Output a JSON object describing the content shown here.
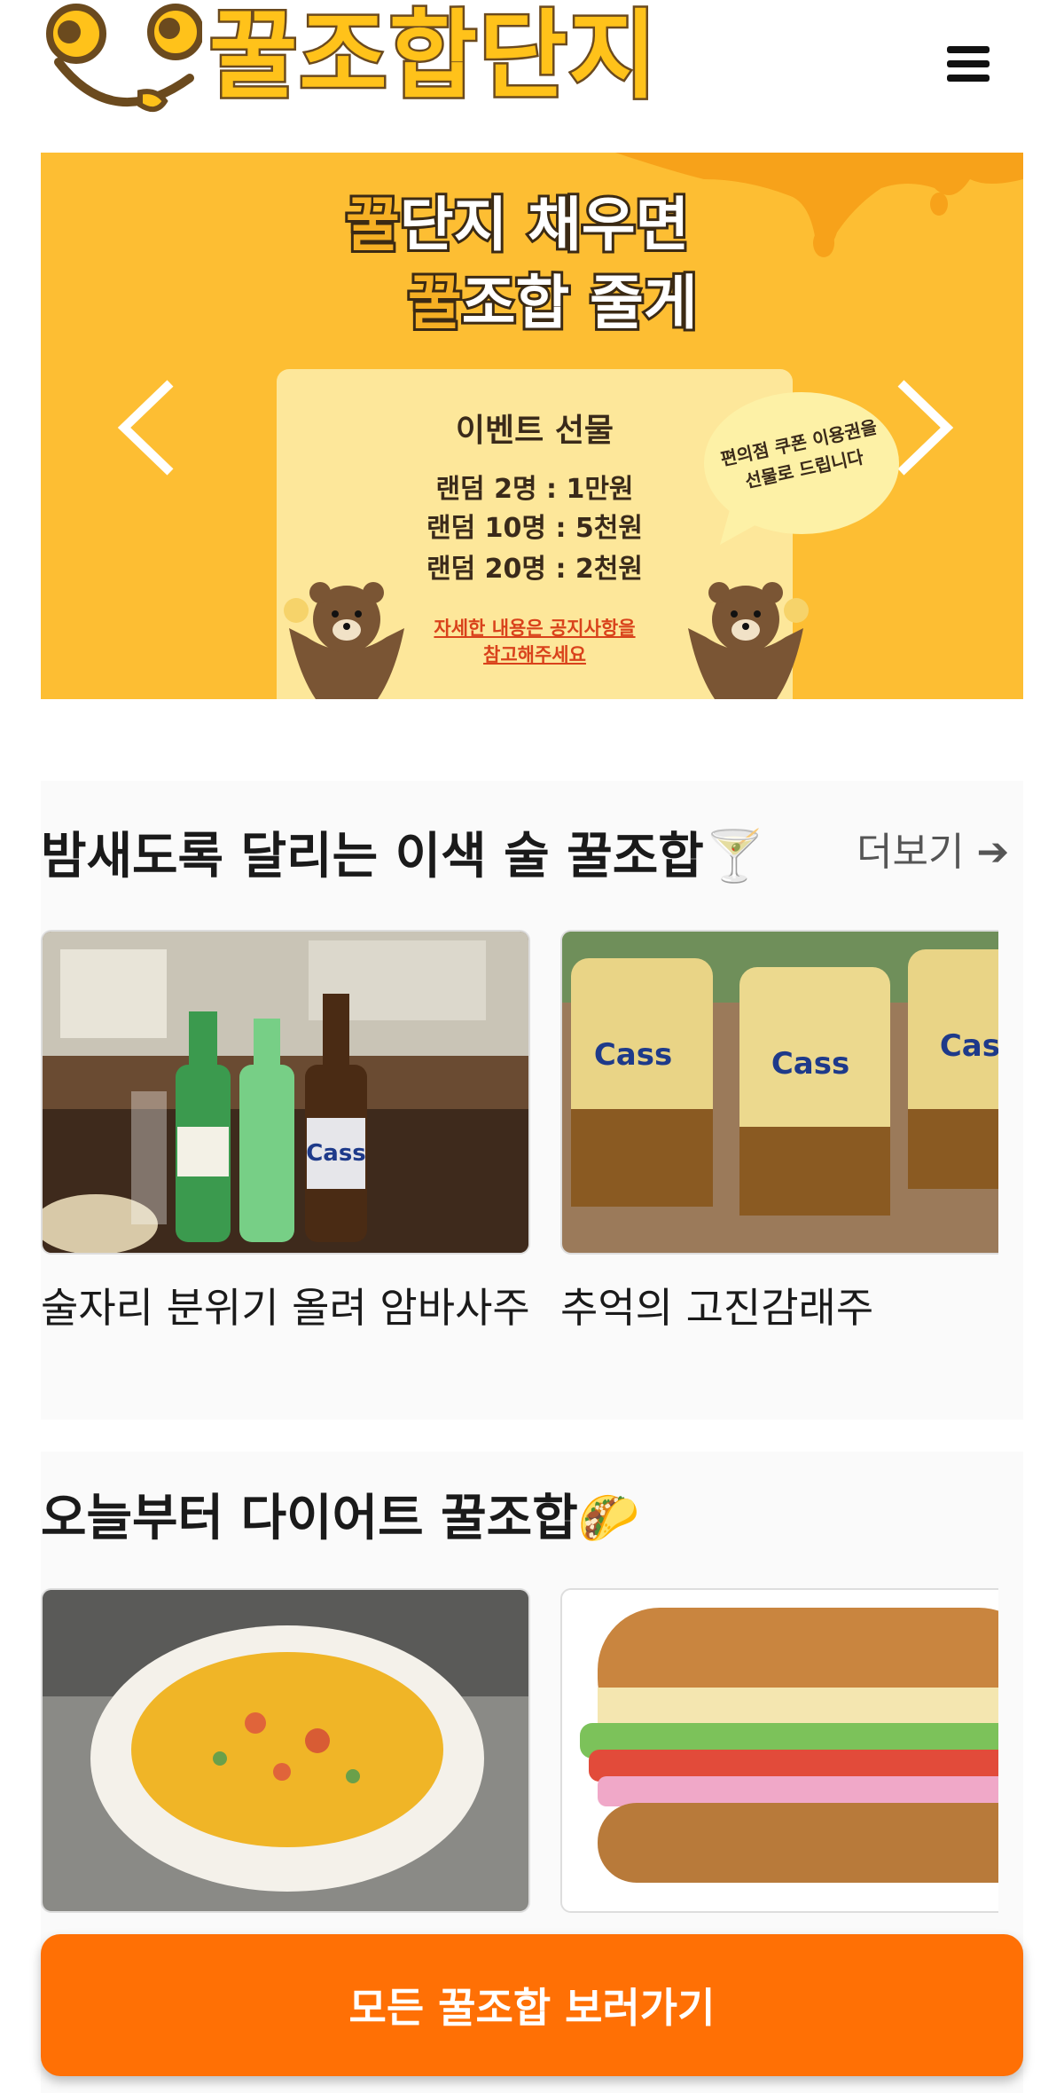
{
  "header": {
    "logo_text": "꿀조합단지",
    "menu_icon": "hamburger-menu-icon"
  },
  "banner": {
    "title_line1_highlight": "꿀",
    "title_line1_rest": "단지 채우면",
    "title_line2_highlight": "꿀",
    "title_line2_rest": "조합 줄게",
    "prize_title": "이벤트 선물",
    "prizes": [
      "랜덤    2명 : 1만원",
      "랜덤 10명 : 5천원",
      "랜덤 20명 : 2천원"
    ],
    "note_line1": "자세한 내용은 공지사항을",
    "note_line2": "참고해주세요",
    "bubble_line1": "편의점 쿠폰 이용권을",
    "bubble_line2": "선물로 드립니다",
    "prev_icon": "chevron-left-icon",
    "next_icon": "chevron-right-icon"
  },
  "sections": [
    {
      "title": "밤새도록 달리는 이색 술 꿀조합🍸",
      "more_label": "더보기 ➔",
      "cards": [
        {
          "title": "술자리 분위기 올려 암바사주"
        },
        {
          "title": "추억의 고진감래주"
        }
      ]
    },
    {
      "title": "오늘부터 다이어트 꿀조합🌮",
      "cards": [
        {
          "title": ""
        },
        {
          "title": ""
        }
      ]
    }
  ],
  "cta": {
    "label": "모든 꿀조합 보러가기"
  },
  "colors": {
    "brand_yellow": "#fdbe33",
    "cta_orange": "#ff7005",
    "logo_outline": "#6b4a1e"
  }
}
